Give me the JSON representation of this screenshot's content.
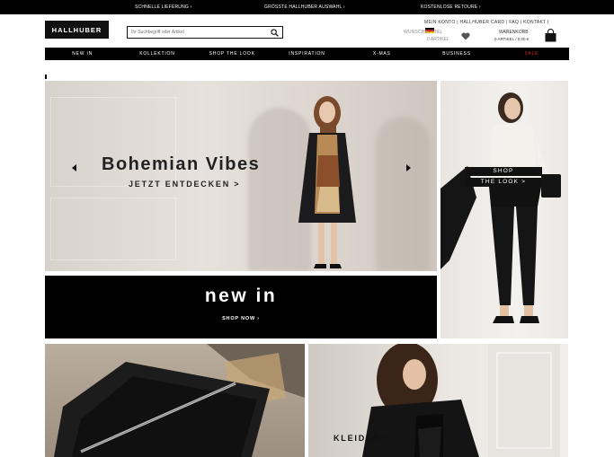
{
  "topbar": {
    "item1": "SCHNELLE LIEFERUNG ›",
    "item2": "GRÖSSTE HALLHUBER AUSWAHL ›",
    "item3": "KOSTENLOSE RETOURE ›"
  },
  "header": {
    "logo": "HALLHUBER",
    "search_placeholder": "Ihr Suchbegriff oder Artikel",
    "account_links": "MEIN KONTO | HALLHUBER CARD | FAQ | KONTAKT |",
    "wishlist_label": "WUNSCHZETTEL",
    "wishlist_count": "0 ARTIKEL",
    "cart_label": "WARENKORB",
    "cart_count": "0 ARTIKEL / 0,00 €"
  },
  "nav": {
    "items": [
      "NEW IN",
      "KOLLEKTION",
      "SHOP THE LOOK",
      "INSPIRATION",
      "X-MAS",
      "BUSINESS",
      "SALE"
    ]
  },
  "hero": {
    "title": "Bohemian Vibes",
    "cta": "JETZT ENTDECKEN >"
  },
  "newin": {
    "title": "new in",
    "cta": "SHOP NOW ›"
  },
  "shop_the_look": {
    "line1": "SHOP",
    "line2": "THE LOOK >"
  },
  "tiles": {
    "dress_cta": "KLEIDER >"
  },
  "colors": {
    "brand_black": "#000000",
    "sale_red": "#dd2222"
  }
}
